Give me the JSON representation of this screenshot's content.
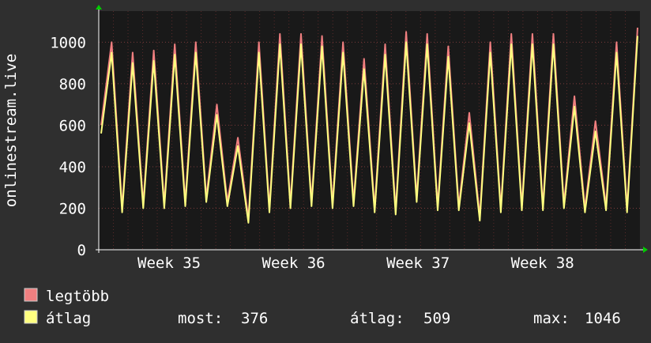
{
  "chart_data": {
    "type": "line",
    "ylabel": "onlinestream.live",
    "ylim": [
      0,
      1150
    ],
    "yticks": [
      0,
      200,
      400,
      600,
      800,
      1000
    ],
    "xlabels": [
      "Week 35",
      "Week 36",
      "Week 37",
      "Week 38"
    ],
    "grid": true,
    "legend_placement": "bottom-left",
    "series": [
      {
        "name": "legtöbb",
        "color": "#f07f80",
        "values": [
          600,
          1000,
          200,
          950,
          220,
          960,
          220,
          990,
          230,
          1000,
          250,
          700,
          230,
          540,
          150,
          1000,
          200,
          1040,
          220,
          1040,
          230,
          1030,
          220,
          1000,
          230,
          920,
          200,
          990,
          190,
          1050,
          250,
          1040,
          210,
          980,
          210,
          660,
          160,
          1000,
          200,
          1040,
          210,
          1040,
          210,
          1040,
          220,
          740,
          200,
          620,
          210,
          1000,
          200,
          1070
        ]
      },
      {
        "name": "átlag",
        "color": "#ffff80",
        "values": [
          560,
          950,
          180,
          900,
          200,
          910,
          200,
          940,
          210,
          950,
          230,
          650,
          210,
          500,
          130,
          950,
          180,
          990,
          200,
          990,
          210,
          980,
          200,
          950,
          210,
          870,
          180,
          940,
          170,
          1000,
          230,
          990,
          190,
          930,
          190,
          610,
          140,
          950,
          180,
          990,
          190,
          990,
          190,
          990,
          200,
          690,
          180,
          570,
          190,
          950,
          180,
          1030
        ]
      }
    ],
    "stats": {
      "most_label": "most:",
      "most_value": "376",
      "atlag_label": "átlag:",
      "atlag_value": "509",
      "max_label": "max:",
      "max_value": "1046"
    }
  }
}
